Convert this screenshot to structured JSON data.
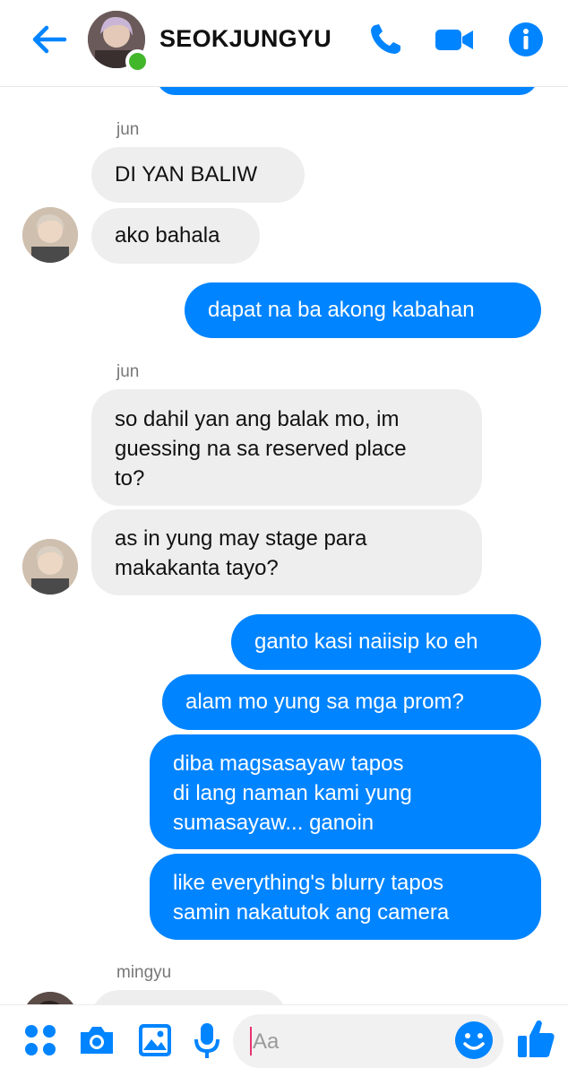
{
  "header": {
    "title": "SEOKJUNGYU",
    "colors": {
      "accent": "#0084ff",
      "online": "#42b72a"
    },
    "icons": [
      "back-arrow-icon",
      "phone-icon",
      "video-camera-icon",
      "info-icon"
    ]
  },
  "messages": [
    {
      "type": "sender",
      "text": "jun"
    },
    {
      "type": "in",
      "text": "DI YAN BALIW"
    },
    {
      "type": "in",
      "text": "ako bahala"
    },
    {
      "type": "out",
      "text": "dapat na ba akong kabahan"
    },
    {
      "type": "sender",
      "text": "jun"
    },
    {
      "type": "in",
      "lines": [
        "so dahil yan ang balak mo, im",
        "guessing na sa reserved place",
        "to?"
      ]
    },
    {
      "type": "in",
      "lines": [
        "as in yung may stage para",
        "makakanta tayo?"
      ]
    },
    {
      "type": "out",
      "text": "ganto kasi naiisip ko eh"
    },
    {
      "type": "out",
      "text": "alam mo yung sa mga prom?"
    },
    {
      "type": "out",
      "lines": [
        "diba magsasayaw tapos",
        "di lang naman kami yung",
        "sumasayaw... ganoin"
      ]
    },
    {
      "type": "out",
      "lines": [
        "like everything's blurry tapos",
        "samin nakatutok ang camera"
      ]
    },
    {
      "type": "sender",
      "text": "mingyu"
    }
  ],
  "composer": {
    "placeholder": "Aa",
    "icons": [
      "apps-icon",
      "camera-icon",
      "image-icon",
      "mic-icon",
      "emoji-icon",
      "thumbs-up-icon"
    ]
  }
}
